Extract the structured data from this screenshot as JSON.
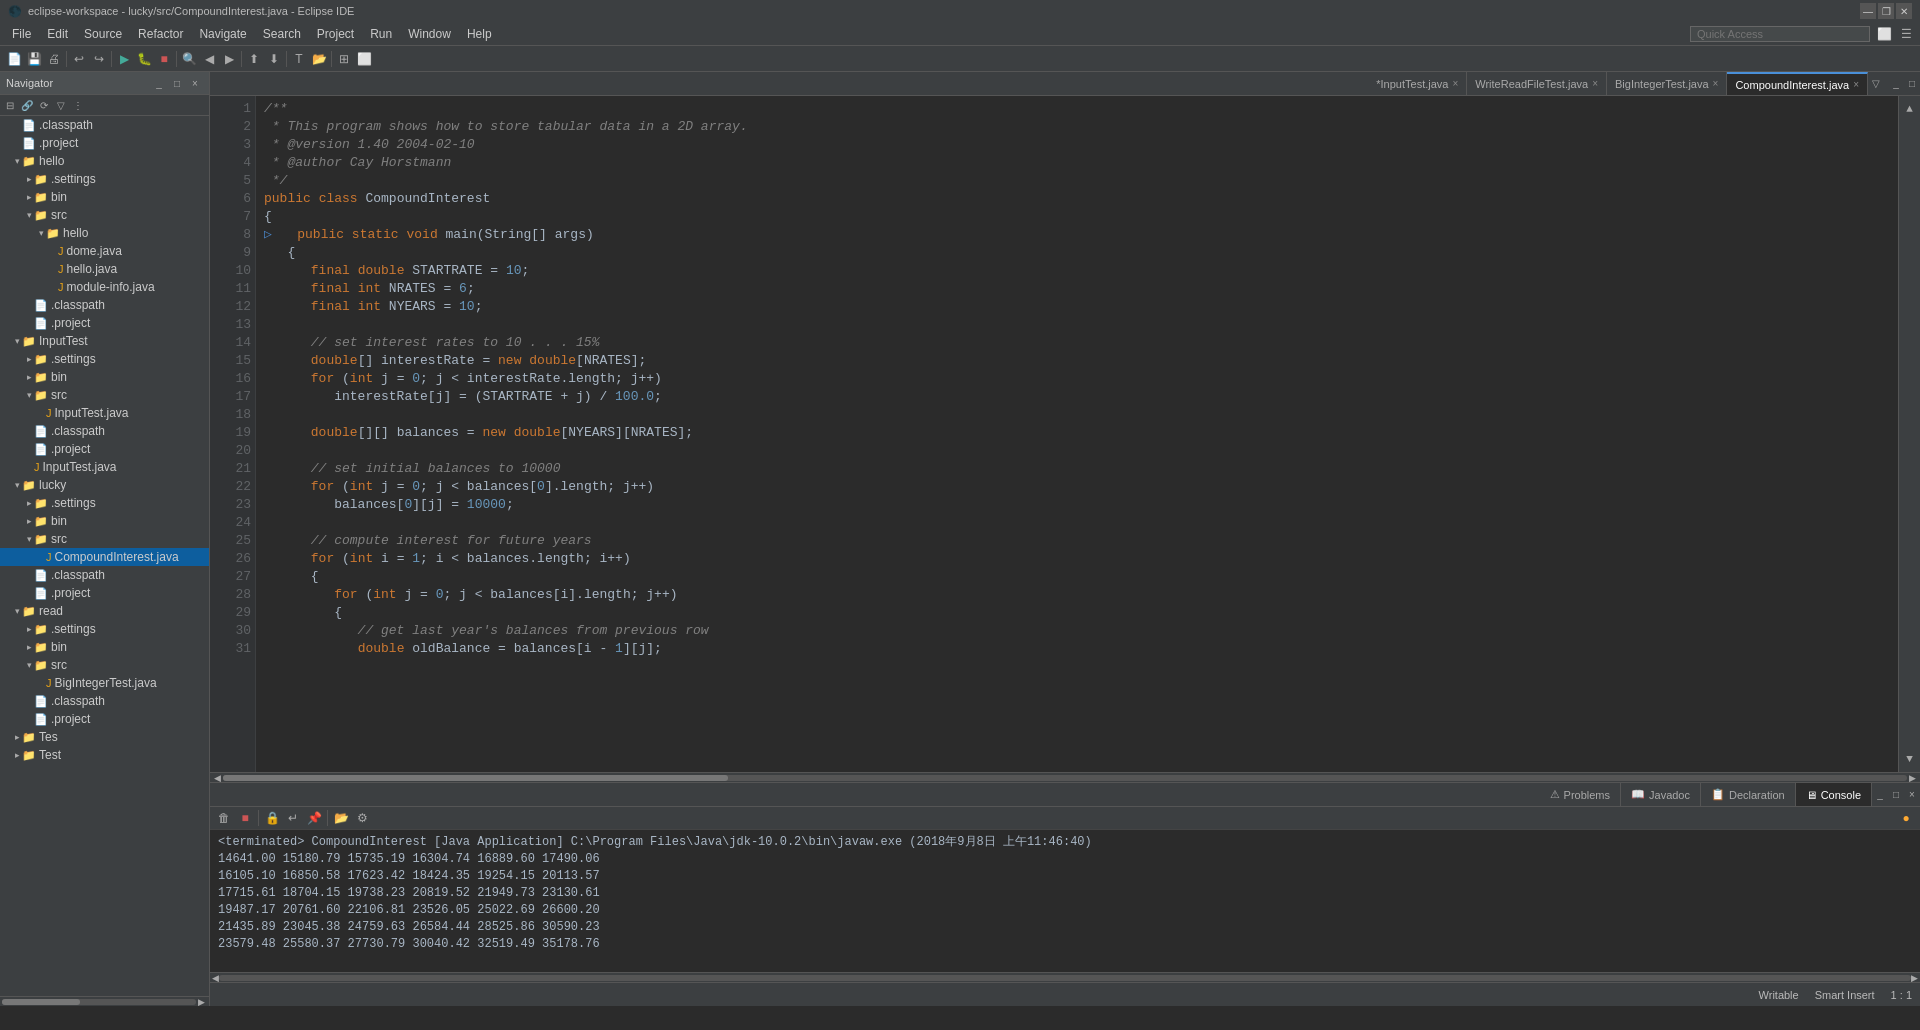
{
  "titlebar": {
    "title": "eclipse-workspace - lucky/src/CompoundInterest.java - Eclipse IDE",
    "min": "—",
    "max": "❐",
    "close": "✕"
  },
  "menubar": {
    "items": [
      "File",
      "Edit",
      "Source",
      "Refactor",
      "Navigate",
      "Search",
      "Project",
      "Run",
      "Window",
      "Help"
    ],
    "quick_access_placeholder": "Quick Access"
  },
  "navigator": {
    "title": "Navigator",
    "tree": [
      {
        "label": ".classpath",
        "indent": 1,
        "type": "file",
        "icon": "📄"
      },
      {
        "label": ".project",
        "indent": 1,
        "type": "file",
        "icon": "📄"
      },
      {
        "label": "hello",
        "indent": 1,
        "type": "folder",
        "icon": "📁",
        "expanded": true
      },
      {
        "label": ".settings",
        "indent": 2,
        "type": "folder",
        "icon": "📁"
      },
      {
        "label": "bin",
        "indent": 2,
        "type": "folder",
        "icon": "📁"
      },
      {
        "label": "src",
        "indent": 2,
        "type": "folder",
        "icon": "📁",
        "expanded": true
      },
      {
        "label": "hello",
        "indent": 3,
        "type": "folder",
        "icon": "📁",
        "expanded": true
      },
      {
        "label": "dome.java",
        "indent": 4,
        "type": "java",
        "icon": "☕"
      },
      {
        "label": "hello.java",
        "indent": 4,
        "type": "java",
        "icon": "☕"
      },
      {
        "label": "module-info.java",
        "indent": 4,
        "type": "java",
        "icon": "☕"
      },
      {
        "label": ".classpath",
        "indent": 2,
        "type": "file",
        "icon": "📄"
      },
      {
        "label": ".project",
        "indent": 2,
        "type": "file",
        "icon": "📄"
      },
      {
        "label": "InputTest",
        "indent": 1,
        "type": "folder",
        "icon": "📁",
        "expanded": true
      },
      {
        "label": ".settings",
        "indent": 2,
        "type": "folder",
        "icon": "📁"
      },
      {
        "label": "bin",
        "indent": 2,
        "type": "folder",
        "icon": "📁"
      },
      {
        "label": "src",
        "indent": 2,
        "type": "folder",
        "icon": "📁",
        "expanded": true
      },
      {
        "label": "InputTest.java",
        "indent": 3,
        "type": "java",
        "icon": "☕"
      },
      {
        "label": ".classpath",
        "indent": 2,
        "type": "file",
        "icon": "📄"
      },
      {
        "label": ".project",
        "indent": 2,
        "type": "file",
        "icon": "📄"
      },
      {
        "label": "InputTest.java",
        "indent": 2,
        "type": "java",
        "icon": "☕"
      },
      {
        "label": "lucky",
        "indent": 1,
        "type": "folder",
        "icon": "📁",
        "expanded": true
      },
      {
        "label": ".settings",
        "indent": 2,
        "type": "folder",
        "icon": "📁"
      },
      {
        "label": "bin",
        "indent": 2,
        "type": "folder",
        "icon": "📁"
      },
      {
        "label": "src",
        "indent": 2,
        "type": "folder",
        "icon": "📁",
        "expanded": true
      },
      {
        "label": "CompoundInterest.java",
        "indent": 3,
        "type": "java",
        "icon": "☕",
        "selected": true
      },
      {
        "label": ".classpath",
        "indent": 2,
        "type": "file",
        "icon": "📄"
      },
      {
        "label": ".project",
        "indent": 2,
        "type": "file",
        "icon": "📄"
      },
      {
        "label": "read",
        "indent": 1,
        "type": "folder",
        "icon": "📁",
        "expanded": true
      },
      {
        "label": ".settings",
        "indent": 2,
        "type": "folder",
        "icon": "📁"
      },
      {
        "label": "bin",
        "indent": 2,
        "type": "folder",
        "icon": "📁"
      },
      {
        "label": "src",
        "indent": 2,
        "type": "folder",
        "icon": "📁",
        "expanded": true
      },
      {
        "label": "BigIntegerTest.java",
        "indent": 3,
        "type": "java",
        "icon": "☕"
      },
      {
        "label": ".classpath",
        "indent": 2,
        "type": "file",
        "icon": "📄"
      },
      {
        "label": ".project",
        "indent": 2,
        "type": "file",
        "icon": "📄"
      },
      {
        "label": "Tes",
        "indent": 1,
        "type": "folder",
        "icon": "📁"
      },
      {
        "label": "Test",
        "indent": 1,
        "type": "folder",
        "icon": "📁"
      }
    ]
  },
  "tabs": [
    {
      "label": "*InputTest.java",
      "active": false,
      "modified": true
    },
    {
      "label": "WriteReadFileTest.java",
      "active": false,
      "modified": false
    },
    {
      "label": "BigIntegerTest.java",
      "active": false,
      "modified": false
    },
    {
      "label": "CompoundInterest.java",
      "active": true,
      "modified": false
    }
  ],
  "code": {
    "lines": [
      {
        "num": "1",
        "content": "/**",
        "type": "comment"
      },
      {
        "num": "2",
        "content": " * This program shows how to store tabular data in a 2D array.",
        "type": "comment"
      },
      {
        "num": "3",
        "content": " * @version 1.40 2004-02-10",
        "type": "comment"
      },
      {
        "num": "4",
        "content": " * @author Cay Horstmann",
        "type": "comment"
      },
      {
        "num": "5",
        "content": " */",
        "type": "comment"
      },
      {
        "num": "6",
        "content": "public class CompoundInterest",
        "type": "code"
      },
      {
        "num": "7",
        "content": "{",
        "type": "code"
      },
      {
        "num": "8",
        "content": "   public static void main(String[] args)",
        "type": "code"
      },
      {
        "num": "9",
        "content": "   {",
        "type": "code"
      },
      {
        "num": "10",
        "content": "      final double STARTRATE = 10;",
        "type": "code"
      },
      {
        "num": "11",
        "content": "      final int NRATES = 6;",
        "type": "code"
      },
      {
        "num": "12",
        "content": "      final int NYEARS = 10;",
        "type": "code"
      },
      {
        "num": "13",
        "content": "",
        "type": "code"
      },
      {
        "num": "14",
        "content": "      // set interest rates to 10 . . . 15%",
        "type": "comment"
      },
      {
        "num": "15",
        "content": "      double[] interestRate = new double[NRATES];",
        "type": "code"
      },
      {
        "num": "16",
        "content": "      for (int j = 0; j < interestRate.length; j++)",
        "type": "code"
      },
      {
        "num": "17",
        "content": "         interestRate[j] = (STARTRATE + j) / 100.0;",
        "type": "code"
      },
      {
        "num": "18",
        "content": "",
        "type": "code"
      },
      {
        "num": "19",
        "content": "      double[][] balances = new double[NYEARS][NRATES];",
        "type": "code"
      },
      {
        "num": "20",
        "content": "",
        "type": "code"
      },
      {
        "num": "21",
        "content": "      // set initial balances to 10000",
        "type": "comment"
      },
      {
        "num": "22",
        "content": "      for (int j = 0; j < balances[0].length; j++)",
        "type": "code"
      },
      {
        "num": "23",
        "content": "         balances[0][j] = 10000;",
        "type": "code"
      },
      {
        "num": "24",
        "content": "",
        "type": "code"
      },
      {
        "num": "25",
        "content": "      // compute interest for future years",
        "type": "comment"
      },
      {
        "num": "26",
        "content": "      for (int i = 1; i < balances.length; i++)",
        "type": "code"
      },
      {
        "num": "27",
        "content": "      {",
        "type": "code"
      },
      {
        "num": "28",
        "content": "         for (int j = 0; j < balances[i].length; j++)",
        "type": "code"
      },
      {
        "num": "29",
        "content": "         {",
        "type": "code"
      },
      {
        "num": "30",
        "content": "            // get last year's balances from previous row",
        "type": "comment"
      },
      {
        "num": "31",
        "content": "            double oldBalance = balances[i - 1][j];",
        "type": "code"
      }
    ]
  },
  "console": {
    "title": "Console",
    "terminated": "<terminated> CompoundInterest [Java Application] C:\\Program Files\\Java\\jdk-10.0.2\\bin\\javaw.exe (2018年9月8日 上午11:46:40)",
    "data": [
      "14641.00  15180.79  15735.19  16304.74  16889.60  17490.06",
      "16105.10  16850.58  17623.42  18424.35  19254.15  20113.57",
      "17715.61  18704.15  19738.23  20819.52  21949.73  23130.61",
      "19487.17  20761.60  22106.81  23526.05  25022.69  26600.20",
      "21435.89  23045.38  24759.63  26584.44  28525.86  30590.23",
      "23579.48  25580.37  27730.79  30040.42  32519.49  35178.76"
    ]
  },
  "bottom_tabs": [
    {
      "label": "Problems",
      "icon": "⚠"
    },
    {
      "label": "Javadoc",
      "icon": "📖"
    },
    {
      "label": "Declaration",
      "icon": "📋"
    },
    {
      "label": "Console",
      "icon": "🖥",
      "active": true
    }
  ],
  "statusbar": {
    "writable": "Writable",
    "insert": "Smart Insert",
    "position": "1 : 1"
  }
}
